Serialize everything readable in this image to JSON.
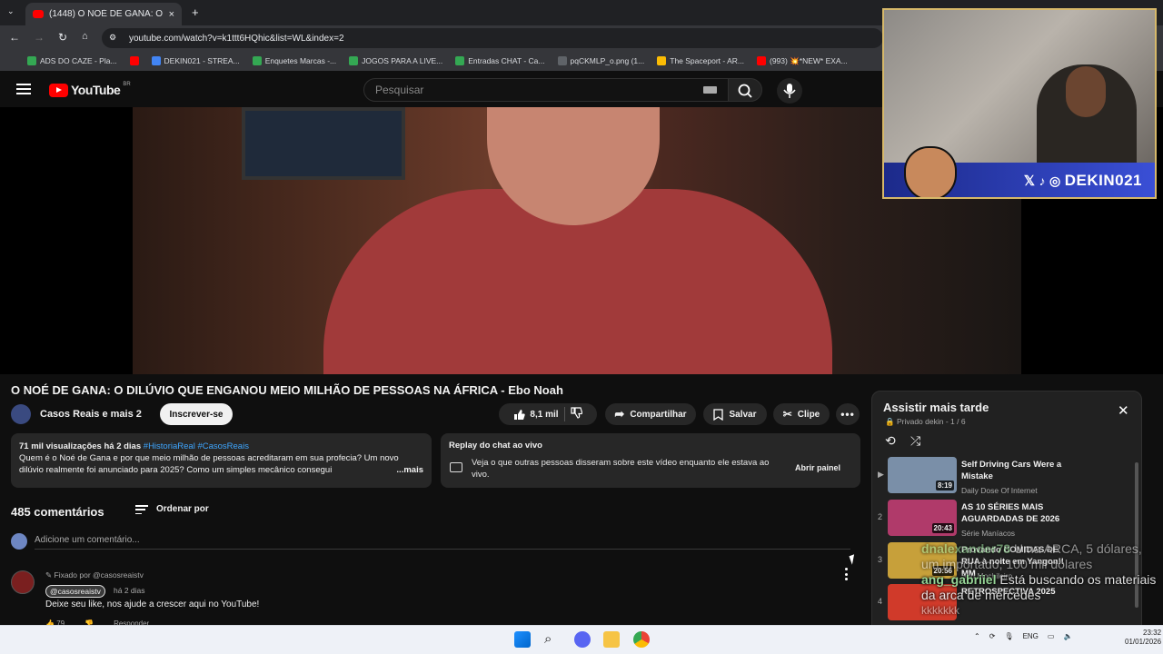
{
  "browser": {
    "tab_title": "(1448) O NOÉ DE GANA: O DILÚ",
    "new_tab": "+",
    "url": "youtube.com/watch?v=k1ttt6HQhic&list=WL&index=2",
    "bookmarks": [
      {
        "label": "ADS DO CAZE - Pla...",
        "color": "#34a853"
      },
      {
        "label": "DEKIN021 - STREA...",
        "color": "#4285f4"
      },
      {
        "label": "Enquetes Marcas -...",
        "color": "#34a853"
      },
      {
        "label": "JOGOS PARA A LIVE...",
        "color": "#34a853"
      },
      {
        "label": "Entradas CHAT - Ca...",
        "color": "#34a853"
      },
      {
        "label": "pqCKMLP_o.png (1...",
        "color": "#5f6368"
      },
      {
        "label": "The Spaceport - AR...",
        "color": "#fbbc04"
      },
      {
        "label": "(993) 💥*NEW* EXA...",
        "color": "#ff0000"
      }
    ]
  },
  "youtube": {
    "logo_text": "YouTube",
    "country": "BR",
    "search_placeholder": "Pesquisar"
  },
  "webcam": {
    "handle": "DEKIN021"
  },
  "video": {
    "title": "O NOÉ DE GANA: O DILÚVIO QUE ENGANOU MEIO MILHÃO DE PESSOAS NA ÁFRICA - Ebo Noah",
    "channel": "Casos Reais e mais 2",
    "subscribe": "Inscrever-se",
    "likes": "8,1 mil",
    "share": "Compartilhar",
    "save": "Salvar",
    "clip": "Clipe"
  },
  "description": {
    "stats": "71 mil visualizações  há 2 dias",
    "tags": "#HistoriaReal #CasosReais",
    "text": "Quem é o Noé de Gana e por que meio milhão de pessoas acreditaram em sua profecia? Um novo dilúvio realmente foi anunciado para 2025? Como um simples mecânico consegui",
    "more": "...mais"
  },
  "chat_replay": {
    "title": "Replay do chat ao vivo",
    "text": "Veja o que outras pessoas disseram sobre este vídeo enquanto ele estava ao vivo.",
    "button": "Abrir painel"
  },
  "comments": {
    "count": "485 comentários",
    "sort": "Ordenar por",
    "add_placeholder": "Adicione um comentário...",
    "pinned": {
      "label": "Fixado por @casosreaistv",
      "author": "@casosreaistv",
      "time": "há 2 dias",
      "text": "Deixe seu like, nos ajude a crescer aqui no YouTube!",
      "likes": "79",
      "reply": "Responder"
    }
  },
  "playlist": {
    "title": "Assistir mais tarde",
    "meta": "Privado dekin - 1 / 6",
    "items": [
      {
        "index": "▶",
        "title": "Self Driving Cars Were a Mistake",
        "channel": "Daily Dose Of Internet",
        "duration": "8:19",
        "thumb": "#7a8fa8"
      },
      {
        "index": "2",
        "title": "AS 10 SÉRIES MAIS AGUARDADAS DE 2026",
        "channel": "Série Maníacos",
        "duration": "20:43",
        "thumb": "#b03a6a"
      },
      {
        "index": "3",
        "title": "Provando COMIDAS DE RUA à noite em Yangon!! MM",
        "channel": "Sou Mochileiro",
        "duration": "20:56",
        "thumb": "#c7a03a"
      },
      {
        "index": "4",
        "title": "RETROSPECTIVA 2025",
        "channel": "",
        "duration": "",
        "thumb": "#d03a2a"
      }
    ]
  },
  "chat_overlay": {
    "line1_user": "dnalexander78",
    "line1_text": "Uma ARCA, 5 dólares, um importado, 100 mil dólares",
    "line2_user": "ang_gabriiel",
    "line2_text": "Está buscando os materiais da arca de mercedes",
    "line3_text": "kkkkkkk"
  },
  "taskbar": {
    "lang": "ENG",
    "time": "23:32",
    "date": "01/01/2026"
  }
}
